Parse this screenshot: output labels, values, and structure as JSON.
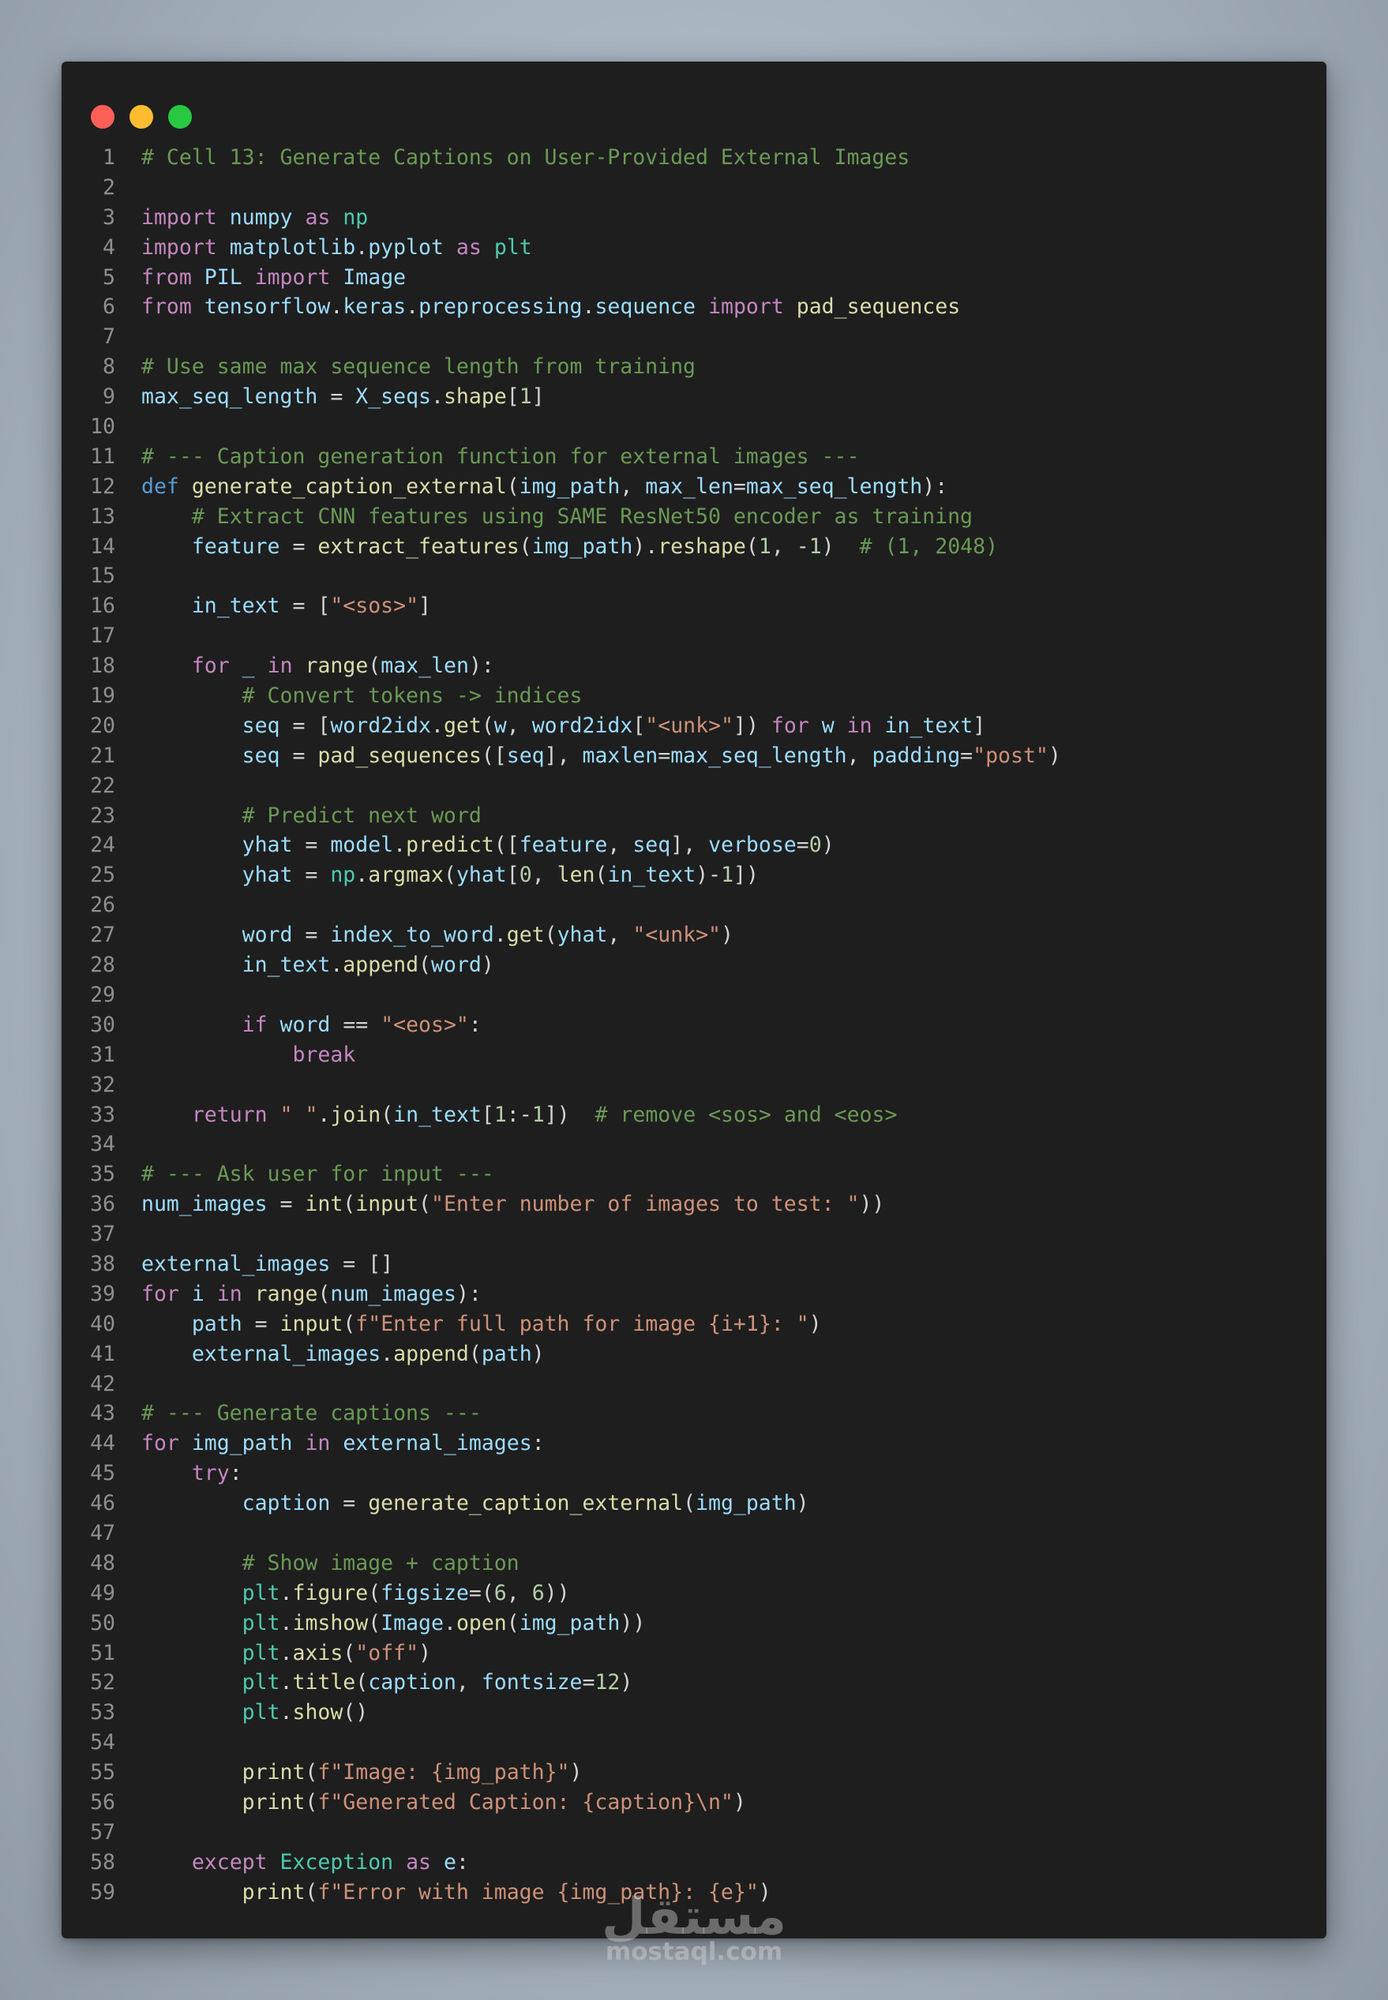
{
  "window": {
    "controls": {
      "close_color": "#ff5f57",
      "minimize_color": "#febc2e",
      "maximize_color": "#28c840"
    },
    "theme": {
      "background": "#1e1e1e",
      "keyword": "#c586c0",
      "storage": "#569cd6",
      "function": "#dcdcaa",
      "variable": "#9cdcfe",
      "class": "#4ec9b0",
      "string": "#ce9178",
      "number": "#b5cea8",
      "comment": "#6a9955"
    }
  },
  "code": {
    "language": "python",
    "lines": [
      "# Cell 13: Generate Captions on User-Provided External Images",
      "",
      "import numpy as np",
      "import matplotlib.pyplot as plt",
      "from PIL import Image",
      "from tensorflow.keras.preprocessing.sequence import pad_sequences",
      "",
      "# Use same max sequence length from training",
      "max_seq_length = X_seqs.shape[1]",
      "",
      "# --- Caption generation function for external images ---",
      "def generate_caption_external(img_path, max_len=max_seq_length):",
      "    # Extract CNN features using SAME ResNet50 encoder as training",
      "    feature = extract_features(img_path).reshape(1, -1)  # (1, 2048)",
      "",
      "    in_text = [\"<sos>\"]",
      "",
      "    for _ in range(max_len):",
      "        # Convert tokens -> indices",
      "        seq = [word2idx.get(w, word2idx[\"<unk>\"]) for w in in_text]",
      "        seq = pad_sequences([seq], maxlen=max_seq_length, padding=\"post\")",
      "",
      "        # Predict next word",
      "        yhat = model.predict([feature, seq], verbose=0)",
      "        yhat = np.argmax(yhat[0, len(in_text)-1])",
      "",
      "        word = index_to_word.get(yhat, \"<unk>\")",
      "        in_text.append(word)",
      "",
      "        if word == \"<eos>\":",
      "            break",
      "",
      "    return \" \".join(in_text[1:-1])  # remove <sos> and <eos>",
      "",
      "# --- Ask user for input ---",
      "num_images = int(input(\"Enter number of images to test: \"))",
      "",
      "external_images = []",
      "for i in range(num_images):",
      "    path = input(f\"Enter full path for image {i+1}: \")",
      "    external_images.append(path)",
      "",
      "# --- Generate captions ---",
      "for img_path in external_images:",
      "    try:",
      "        caption = generate_caption_external(img_path)",
      "",
      "        # Show image + caption",
      "        plt.figure(figsize=(6, 6))",
      "        plt.imshow(Image.open(img_path))",
      "        plt.axis(\"off\")",
      "        plt.title(caption, fontsize=12)",
      "        plt.show()",
      "",
      "        print(f\"Image: {img_path}\")",
      "        print(f\"Generated Caption: {caption}\\n\")",
      "",
      "    except Exception as e:",
      "        print(f\"Error with image {img_path}: {e}\")"
    ]
  },
  "watermark": {
    "arabic": "مستقل",
    "url": "mostaql.com"
  }
}
